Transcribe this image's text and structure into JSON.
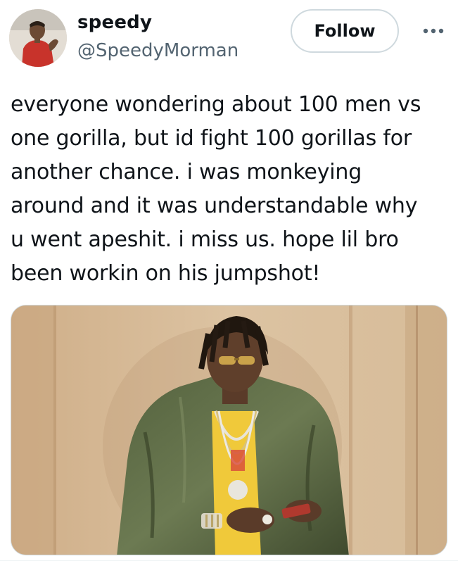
{
  "tweet": {
    "author": {
      "display_name": "speedy",
      "handle": "@SpeedyMorman"
    },
    "follow_label": "Follow",
    "more_icon": "more-horizontal-icon",
    "text_lines": [
      "everyone wondering about 100 men vs",
      "one gorilla, but id fight 100 gorillas for",
      "another chance. i was monkeying",
      "around and it was understandable why",
      "u went apeshit. i miss us. hope lil bro",
      "been workin on his jumpshot!"
    ]
  },
  "colors": {
    "text_primary": "#0f1419",
    "text_secondary": "#536471",
    "border": "#cfd9de"
  }
}
